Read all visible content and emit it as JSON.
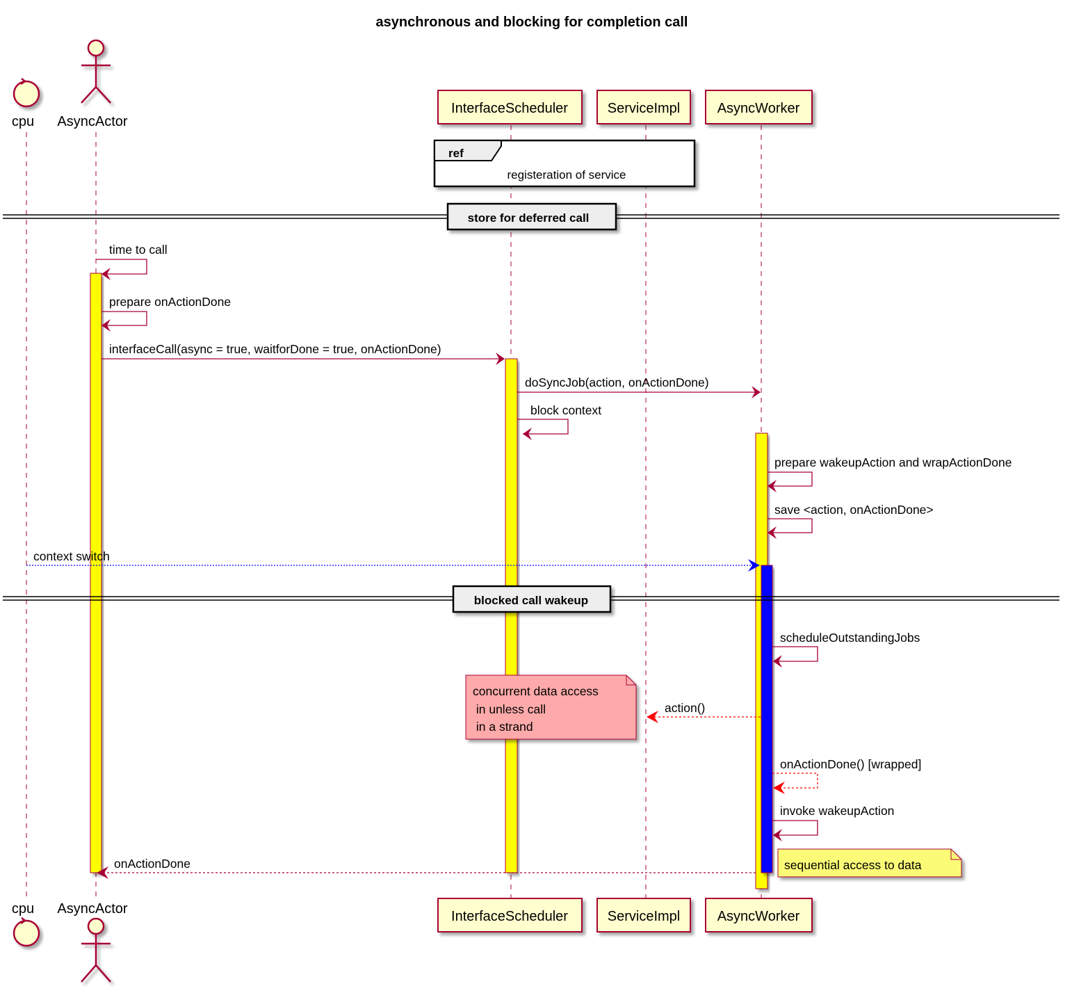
{
  "title": "asynchronous and blocking for completion call",
  "participants": [
    {
      "id": "cpu",
      "label": "cpu",
      "kind": "control"
    },
    {
      "id": "actor",
      "label": "AsyncActor",
      "kind": "actor"
    },
    {
      "id": "scheduler",
      "label": "InterfaceScheduler",
      "kind": "participant"
    },
    {
      "id": "service",
      "label": "ServiceImpl",
      "kind": "participant"
    },
    {
      "id": "worker",
      "label": "AsyncWorker",
      "kind": "participant"
    }
  ],
  "ref": {
    "tag": "ref",
    "text": "registeration of service"
  },
  "dividers": [
    {
      "label": "store for deferred call"
    },
    {
      "label": "blocked call wakeup"
    }
  ],
  "messages": [
    {
      "from": "actor",
      "to": "actor",
      "label": "time to call",
      "style": "solid",
      "color": "#A80036"
    },
    {
      "from": "actor",
      "to": "actor",
      "label": "prepare onActionDone",
      "style": "solid",
      "color": "#A80036"
    },
    {
      "from": "actor",
      "to": "scheduler",
      "label": "interfaceCall(async = true, waitforDone = true, onActionDone)",
      "style": "solid",
      "color": "#A80036"
    },
    {
      "from": "scheduler",
      "to": "worker",
      "label": "doSyncJob(action, onActionDone)",
      "style": "solid",
      "color": "#A80036"
    },
    {
      "from": "scheduler",
      "to": "scheduler",
      "label": "block context",
      "style": "solid",
      "color": "#A80036"
    },
    {
      "from": "worker",
      "to": "worker",
      "label": "prepare wakeupAction and wrapActionDone",
      "style": "solid",
      "color": "#A80036"
    },
    {
      "from": "worker",
      "to": "worker",
      "label": "save <action, onActionDone>",
      "style": "solid",
      "color": "#A80036"
    },
    {
      "from": "cpu",
      "to": "worker",
      "label": "context switch",
      "style": "dotted",
      "color": "#0000FF"
    },
    {
      "from": "worker",
      "to": "worker",
      "label": "scheduleOutstandingJobs",
      "style": "solid",
      "color": "#A80036"
    },
    {
      "from": "worker",
      "to": "service",
      "label": "action()",
      "style": "dashed",
      "color": "#FF0000"
    },
    {
      "from": "worker",
      "to": "worker",
      "label": "onActionDone() [wrapped]",
      "style": "dashed",
      "color": "#FF0000"
    },
    {
      "from": "worker",
      "to": "worker",
      "label": "invoke wakeupAction",
      "style": "solid",
      "color": "#A80036"
    },
    {
      "from": "worker",
      "to": "actor",
      "label": "onActionDone",
      "style": "dashed",
      "color": "#A80036"
    }
  ],
  "notes": [
    {
      "lines": [
        "concurrent data access",
        " in unless call",
        " in a strand"
      ],
      "color": "#FFAAAA"
    },
    {
      "lines": [
        "sequential access to data"
      ],
      "color": "#FBFB77"
    }
  ],
  "activation_colors": {
    "yellow": "#FFFF00",
    "blue": "#0000FF"
  },
  "colors": {
    "border": "#A80036",
    "participant_fill": "#FEFECE",
    "divider_fill": "#EEEEEE"
  }
}
